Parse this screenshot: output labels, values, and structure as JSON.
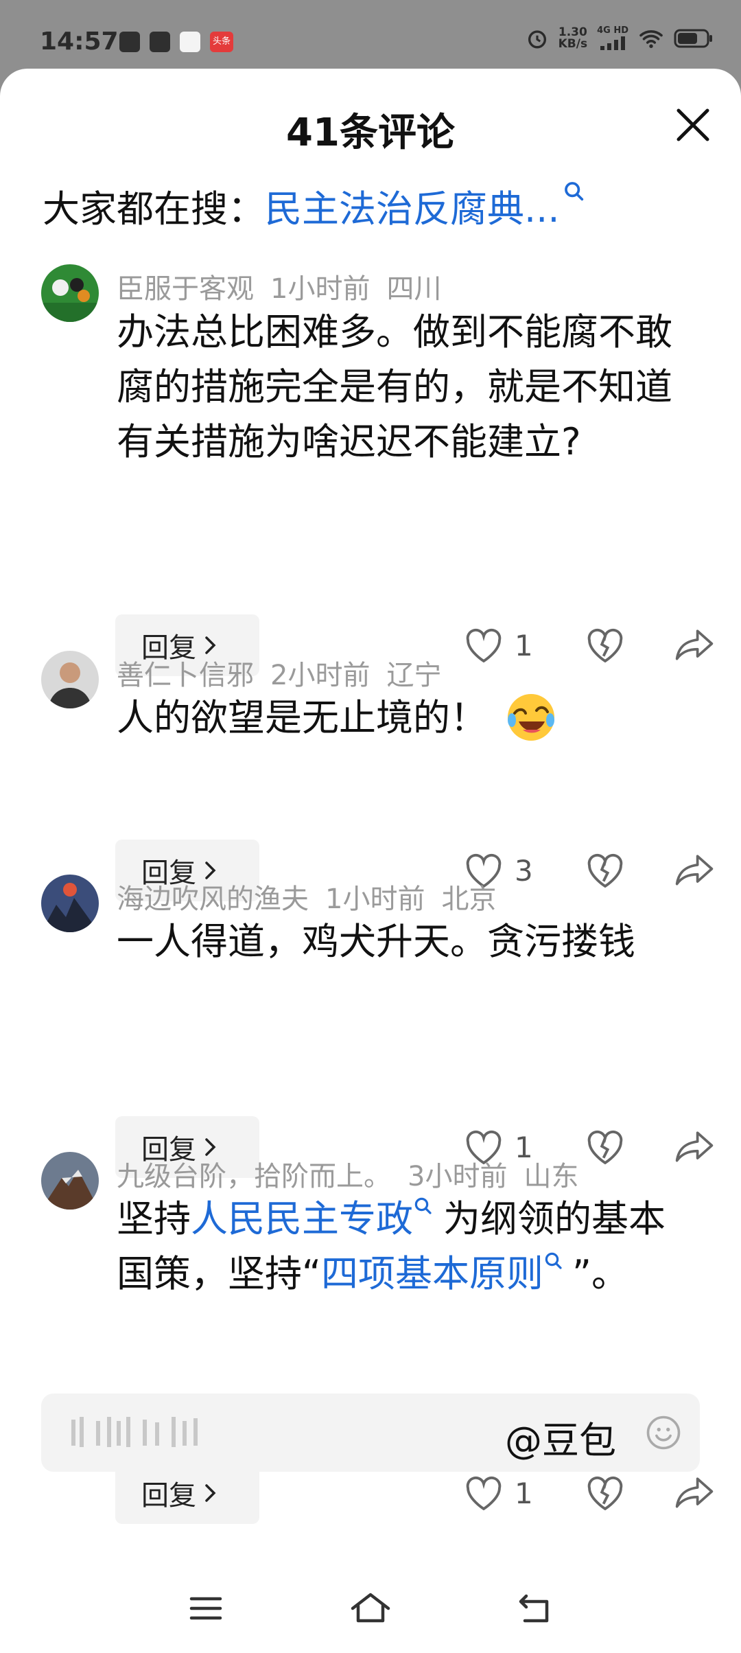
{
  "status_bar": {
    "time": "14:57",
    "app_badge_text": "头条",
    "speed_value": "1.30",
    "speed_unit": "KB/s",
    "network": "4G HD"
  },
  "sheet": {
    "title": "41条评论",
    "search_prefix": "大家都在搜：",
    "search_link": "民主法治反腐典..."
  },
  "comments": [
    {
      "user": "臣服于客观",
      "time": "1小时前",
      "location": "四川",
      "text": "办法总比困难多。做到不能腐不敢腐的措施完全是有的，就是不知道有关措施为啥迟迟不能建立?",
      "reply_label": "回复",
      "likes": "1"
    },
    {
      "user": "善仁卜信邪",
      "time": "2小时前",
      "location": "辽宁",
      "text": "人的欲望是无止境的！",
      "reply_label": "回复",
      "likes": "3"
    },
    {
      "user": "海边吹风的渔夫",
      "time": "1小时前",
      "location": "北京",
      "text": "一人得道，鸡犬升天。贪污搂钱",
      "reply_label": "回复",
      "likes": "1"
    },
    {
      "user": "九级台阶，拾阶而上。",
      "time": "3小时前",
      "location": "山东",
      "text_part1": "坚持",
      "link1": "人民民主专政",
      "text_part2": "为纲领的基本国策，坚持“",
      "link2": "四项基本原则",
      "text_part3": "”。",
      "reply_label": "回复",
      "likes": "1"
    }
  ],
  "input_bar": {
    "at_label": "@豆包"
  },
  "colors": {
    "link": "#1e6ad6",
    "meta": "#9a9a9a",
    "statusbar_bg": "#8f8f8f"
  }
}
